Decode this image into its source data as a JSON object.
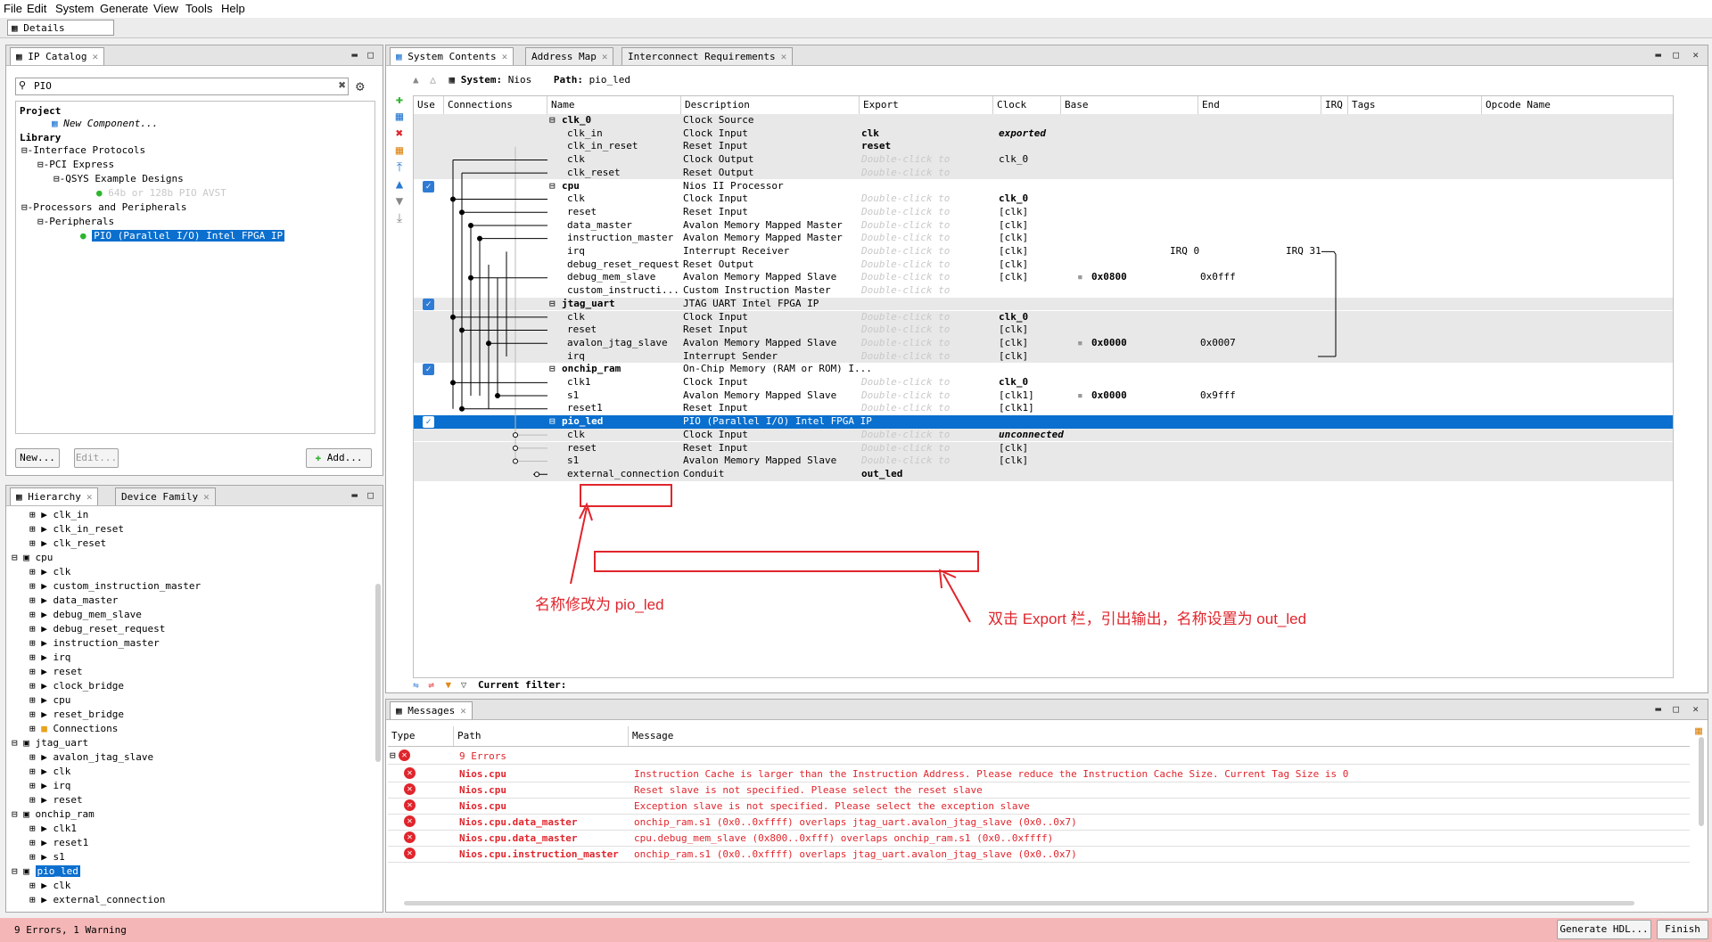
{
  "menu": [
    "File",
    "Edit",
    "System",
    "Generate",
    "View",
    "Tools",
    "Help"
  ],
  "details_tab": "Details",
  "ip_catalog": {
    "tab": "IP Catalog",
    "search_value": "PIO",
    "tree": [
      {
        "label": "Project",
        "bold": true
      },
      {
        "label": "New Component...",
        "italic": true
      },
      {
        "label": "Library",
        "bold": true
      },
      {
        "label": "Interface Protocols"
      },
      {
        "label": "PCI Express"
      },
      {
        "label": "QSYS Example Designs"
      },
      {
        "label": "64b or 128b PIO AVST",
        "dim": true
      },
      {
        "label": "Processors and Peripherals"
      },
      {
        "label": "Peripherals"
      },
      {
        "label": "PIO (Parallel I/O) Intel FPGA IP",
        "selected": true
      }
    ],
    "buttons": {
      "new": "New...",
      "edit": "Edit...",
      "add": "Add..."
    }
  },
  "hierarchy": {
    "tabs": [
      "Hierarchy",
      "Device Family"
    ],
    "items": [
      {
        "label": "clk_in",
        "level": 2
      },
      {
        "label": "clk_in_reset",
        "level": 2
      },
      {
        "label": "clk_reset",
        "level": 2
      },
      {
        "label": "cpu",
        "level": 1
      },
      {
        "label": "clk",
        "level": 2
      },
      {
        "label": "custom_instruction_master",
        "level": 2
      },
      {
        "label": "data_master",
        "level": 2
      },
      {
        "label": "debug_mem_slave",
        "level": 2
      },
      {
        "label": "debug_reset_request",
        "level": 2
      },
      {
        "label": "instruction_master",
        "level": 2
      },
      {
        "label": "irq",
        "level": 2
      },
      {
        "label": "reset",
        "level": 2
      },
      {
        "label": "clock_bridge",
        "level": 2
      },
      {
        "label": "cpu",
        "level": 2
      },
      {
        "label": "reset_bridge",
        "level": 2
      },
      {
        "label": "Connections",
        "level": 2
      },
      {
        "label": "jtag_uart",
        "level": 1
      },
      {
        "label": "avalon_jtag_slave",
        "level": 2
      },
      {
        "label": "clk",
        "level": 2
      },
      {
        "label": "irq",
        "level": 2
      },
      {
        "label": "reset",
        "level": 2
      },
      {
        "label": "onchip_ram",
        "level": 1
      },
      {
        "label": "clk1",
        "level": 2
      },
      {
        "label": "reset1",
        "level": 2
      },
      {
        "label": "s1",
        "level": 2
      },
      {
        "label": "pio_led",
        "level": 1,
        "selected": true
      },
      {
        "label": "clk",
        "level": 2
      },
      {
        "label": "external_connection",
        "level": 2
      }
    ]
  },
  "system_contents": {
    "tabs": [
      "System Contents",
      "Address Map",
      "Interconnect Requirements"
    ],
    "system_label": "System:",
    "system_name": "Nios",
    "path_label": "Path:",
    "path_value": "pio_led",
    "columns": [
      "Use",
      "Connections",
      "Name",
      "Description",
      "Export",
      "Clock",
      "Base",
      "End",
      "IRQ",
      "Tags",
      "Opcode Name"
    ],
    "rows": [
      {
        "name": "clk_0",
        "desc": "Clock Source",
        "export": "",
        "clock": "",
        "base": "",
        "end": "",
        "type": "module",
        "use": false
      },
      {
        "name": "clk_in",
        "desc": "Clock Input",
        "export": "clk",
        "clock": "exported",
        "base": "",
        "end": "",
        "type": "port"
      },
      {
        "name": "clk_in_reset",
        "desc": "Reset Input",
        "export": "reset",
        "clock": "",
        "base": "",
        "end": "",
        "type": "port"
      },
      {
        "name": "clk",
        "desc": "Clock Output",
        "export": "Double-click to",
        "clock": "clk_0",
        "base": "",
        "end": "",
        "type": "port"
      },
      {
        "name": "clk_reset",
        "desc": "Reset Output",
        "export": "Double-click to",
        "clock": "",
        "base": "",
        "end": "",
        "type": "port"
      },
      {
        "name": "cpu",
        "desc": "Nios II Processor",
        "export": "",
        "clock": "",
        "base": "",
        "end": "",
        "type": "module",
        "use": true
      },
      {
        "name": "clk",
        "desc": "Clock Input",
        "export": "Double-click to",
        "clock": "clk_0",
        "base": "",
        "end": "",
        "type": "port"
      },
      {
        "name": "reset",
        "desc": "Reset Input",
        "export": "Double-click to",
        "clock": "[clk]",
        "base": "",
        "end": "",
        "type": "port"
      },
      {
        "name": "data_master",
        "desc": "Avalon Memory Mapped Master",
        "export": "Double-click to",
        "clock": "[clk]",
        "base": "",
        "end": "",
        "type": "port"
      },
      {
        "name": "instruction_master",
        "desc": "Avalon Memory Mapped Master",
        "export": "Double-click to",
        "clock": "[clk]",
        "base": "",
        "end": "",
        "type": "port"
      },
      {
        "name": "irq",
        "desc": "Interrupt Receiver",
        "export": "Double-click to",
        "clock": "[clk]",
        "base": "",
        "end": "IRQ 0",
        "irq": "IRQ 31",
        "type": "port"
      },
      {
        "name": "debug_reset_request",
        "desc": "Reset Output",
        "export": "Double-click to",
        "clock": "[clk]",
        "base": "",
        "end": "",
        "type": "port"
      },
      {
        "name": "debug_mem_slave",
        "desc": "Avalon Memory Mapped Slave",
        "export": "Double-click to",
        "clock": "[clk]",
        "base": "0x0800",
        "end": "0x0fff",
        "type": "port"
      },
      {
        "name": "custom_instructi...",
        "desc": "Custom Instruction Master",
        "export": "Double-click to",
        "clock": "",
        "base": "",
        "end": "",
        "type": "port"
      },
      {
        "name": "jtag_uart",
        "desc": "JTAG UART Intel FPGA IP",
        "export": "",
        "clock": "",
        "base": "",
        "end": "",
        "type": "module",
        "use": true
      },
      {
        "name": "clk",
        "desc": "Clock Input",
        "export": "Double-click to",
        "clock": "clk_0",
        "base": "",
        "end": "",
        "type": "port"
      },
      {
        "name": "reset",
        "desc": "Reset Input",
        "export": "Double-click to",
        "clock": "[clk]",
        "base": "",
        "end": "",
        "type": "port"
      },
      {
        "name": "avalon_jtag_slave",
        "desc": "Avalon Memory Mapped Slave",
        "export": "Double-click to",
        "clock": "[clk]",
        "base": "0x0000",
        "end": "0x0007",
        "type": "port"
      },
      {
        "name": "irq",
        "desc": "Interrupt Sender",
        "export": "Double-click to",
        "clock": "[clk]",
        "base": "",
        "end": "",
        "type": "port"
      },
      {
        "name": "onchip_ram",
        "desc": "On-Chip Memory (RAM or ROM) I...",
        "export": "",
        "clock": "",
        "base": "",
        "end": "",
        "type": "module",
        "use": true
      },
      {
        "name": "clk1",
        "desc": "Clock Input",
        "export": "Double-click to",
        "clock": "clk_0",
        "base": "",
        "end": "",
        "type": "port"
      },
      {
        "name": "s1",
        "desc": "Avalon Memory Mapped Slave",
        "export": "Double-click to",
        "clock": "[clk1]",
        "base": "0x0000",
        "end": "0x9fff",
        "type": "port"
      },
      {
        "name": "reset1",
        "desc": "Reset Input",
        "export": "Double-click to",
        "clock": "[clk1]",
        "base": "",
        "end": "",
        "type": "port"
      },
      {
        "name": "pio_led",
        "desc": "PIO (Parallel I/O) Intel FPGA IP",
        "export": "",
        "clock": "",
        "base": "",
        "end": "",
        "type": "module",
        "use": true,
        "selected": true
      },
      {
        "name": "clk",
        "desc": "Clock Input",
        "export": "Double-click to",
        "clock": "unconnected",
        "base": "",
        "end": "",
        "type": "port"
      },
      {
        "name": "reset",
        "desc": "Reset Input",
        "export": "Double-click to",
        "clock": "[clk]",
        "base": "",
        "end": "",
        "type": "port"
      },
      {
        "name": "s1",
        "desc": "Avalon Memory Mapped Slave",
        "export": "Double-click to",
        "clock": "[clk]",
        "base": "",
        "end": "",
        "type": "port"
      },
      {
        "name": "external_connection",
        "desc": "Conduit",
        "export": "out_led",
        "clock": "",
        "base": "",
        "end": "",
        "type": "port"
      }
    ],
    "filter_label": "Current filter:"
  },
  "annotations": {
    "rename": "名称修改为 pio_led",
    "export": "双击 Export 栏，引出输出，名称设置为 out_led"
  },
  "messages": {
    "tab": "Messages",
    "columns": [
      "Type",
      "Path",
      "Message"
    ],
    "summary": "9 Errors",
    "rows": [
      {
        "path": "Nios.cpu",
        "msg": "Instruction Cache is larger than the Instruction Address. Please reduce the Instruction Cache Size. Current Tag Size is 0"
      },
      {
        "path": "Nios.cpu",
        "msg": "Reset slave is not specified. Please select the reset slave"
      },
      {
        "path": "Nios.cpu",
        "msg": "Exception slave is not specified. Please select the exception slave"
      },
      {
        "path": "Nios.cpu.data_master",
        "msg": "onchip_ram.s1 (0x0..0xffff) overlaps jtag_uart.avalon_jtag_slave (0x0..0x7)"
      },
      {
        "path": "Nios.cpu.data_master",
        "msg": "cpu.debug_mem_slave (0x800..0xfff) overlaps onchip_ram.s1 (0x0..0xffff)"
      },
      {
        "path": "Nios.cpu.instruction_master",
        "msg": "onchip_ram.s1 (0x0..0xffff) overlaps jtag_uart.avalon_jtag_slave (0x0..0x7)"
      }
    ]
  },
  "status": {
    "text": "9 Errors, 1 Warning",
    "generate_btn": "Generate HDL...",
    "finish_btn": "Finish"
  },
  "colors": {
    "selection": "#0a6fce",
    "error": "#e0252c",
    "status_bg": "#f4b6b6"
  }
}
